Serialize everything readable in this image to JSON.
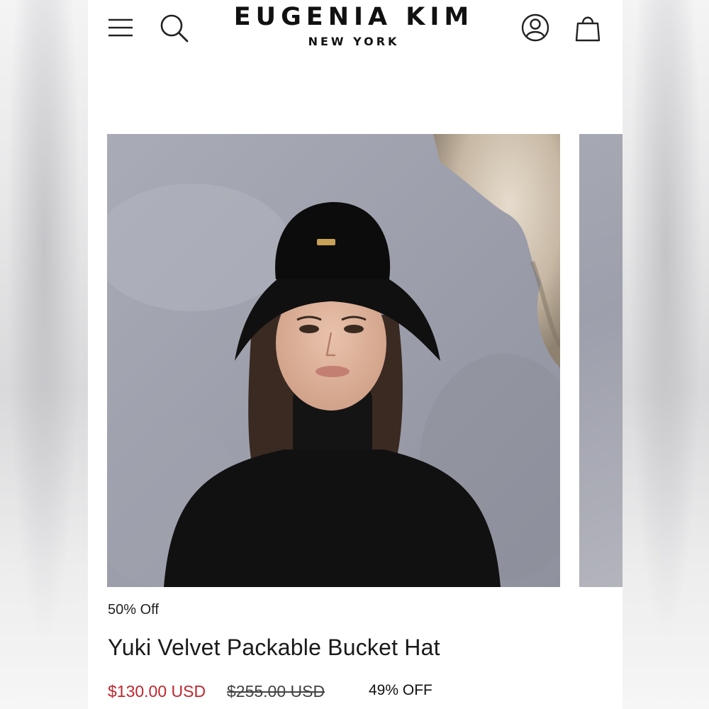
{
  "brand": {
    "name": "EUGENIA KIM",
    "subtitle": "NEW YORK"
  },
  "header": {
    "icons": [
      "menu-icon",
      "search-icon",
      "account-icon",
      "shopping-bag-icon"
    ]
  },
  "product": {
    "promo_label": "50% Off",
    "title": "Yuki Velvet Packable Bucket Hat",
    "sale_price": "$130.00 USD",
    "original_price": "$255.00 USD",
    "discount": "49% OFF"
  },
  "colors": {
    "sale_price": "#c0262d",
    "text": "#1a1a1a",
    "background": "#ffffff"
  }
}
